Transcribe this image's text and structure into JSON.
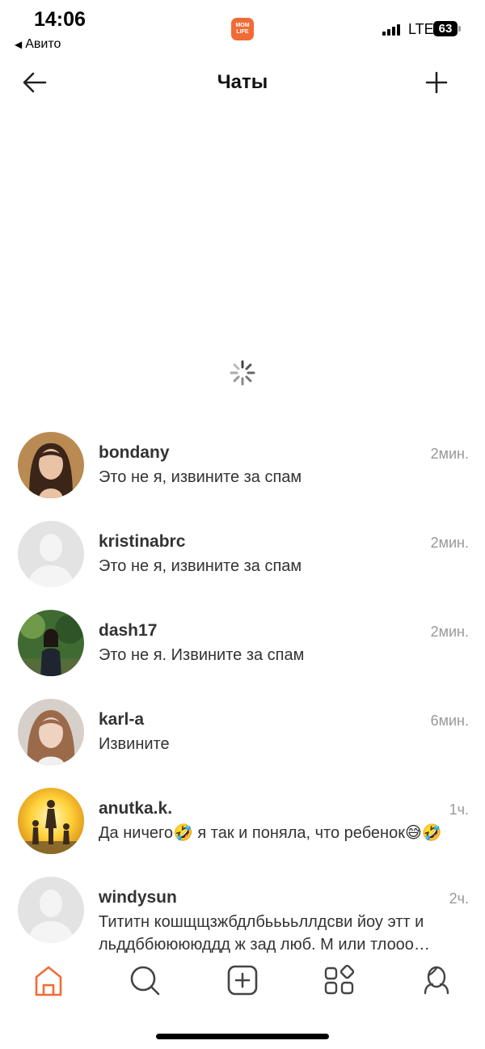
{
  "status_bar": {
    "time": "14:06",
    "back_app": "Авито",
    "network": "LTE",
    "battery": "63",
    "app_logo": "MOM LIFE"
  },
  "header": {
    "title": "Чаты",
    "back_icon": "arrow-left-icon",
    "add_icon": "plus-icon"
  },
  "chats": [
    {
      "name": "bondany",
      "time": "2мин.",
      "message": "Это не я, извините за спам",
      "avatar": "photo"
    },
    {
      "name": "kristinabrc",
      "time": "2мин.",
      "message": "Это не я, извините за спам",
      "avatar": "placeholder"
    },
    {
      "name": "dash17",
      "time": "2мин.",
      "message": "Это не я. Извините за спам",
      "avatar": "photo"
    },
    {
      "name": "karl-a",
      "time": "6мин.",
      "message": "Извините",
      "avatar": "photo"
    },
    {
      "name": "anutka.k.",
      "time": "1ч.",
      "message": "Да ничего🤣 я так и поняла, что ребенок😅🤣",
      "avatar": "photo"
    },
    {
      "name": "windysun",
      "time": "2ч.",
      "message": "Тититн кошщщзжбдлбььььллдсви йоу этт и льддббююююддд  ж зад люб.   М или тлооо…",
      "avatar": "placeholder"
    }
  ],
  "bottom_nav": [
    {
      "icon": "home-icon",
      "active": true
    },
    {
      "icon": "search-icon",
      "active": false
    },
    {
      "icon": "add-post-icon",
      "active": false
    },
    {
      "icon": "services-icon",
      "active": false
    },
    {
      "icon": "profile-icon",
      "active": false
    }
  ],
  "colors": {
    "accent": "#f26b35",
    "text": "#333333",
    "muted": "#999999",
    "placeholder_avatar": "#e3e3e3"
  }
}
